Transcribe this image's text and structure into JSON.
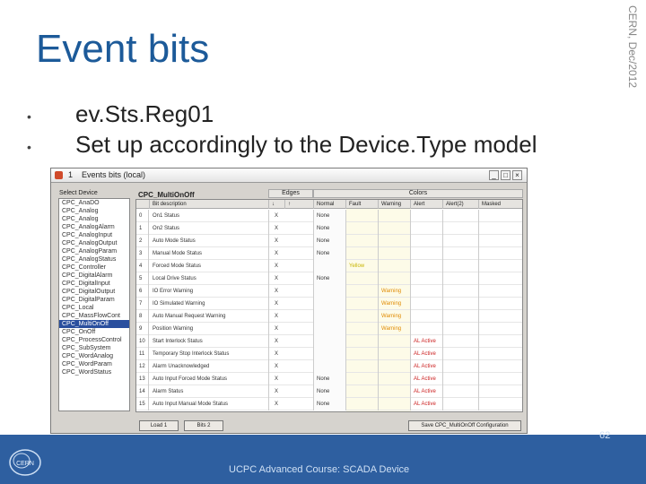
{
  "slide": {
    "title": "Event bits",
    "side_label": "CERN, Dec/2012",
    "bullets": [
      "ev.Sts.Reg01",
      "Set up accordingly to the Device.Type model"
    ],
    "footer_text": "UCPC Advanced Course: SCADA Device",
    "page_number": "62",
    "logo_text": "CERN",
    "footer_color": "#2e5fa0",
    "title_color": "#1c5a99"
  },
  "window": {
    "number": "1",
    "title": "Events bits (local)",
    "controls": [
      "_",
      "□",
      "×"
    ],
    "select_label": "Select Device",
    "model_name": "CPC_MultiOnOff",
    "group_edges": "Edges",
    "group_colors": "Colors",
    "headers": [
      "",
      "Bit description",
      "↓",
      "↑",
      "Normal",
      "Fault",
      "Warning",
      "Alert",
      "Alert(2)",
      "Masked"
    ],
    "devices": [
      "CPC_AnaDO",
      "CPC_Analog",
      "CPC_Analog",
      "CPC_AnalogAlarm",
      "CPC_AnalogInput",
      "CPC_AnalogOutput",
      "CPC_AnalogParam",
      "CPC_AnalogStatus",
      "CPC_Controller",
      "CPC_DigitalAlarm",
      "CPC_DigitalInput",
      "CPC_DigitalOutput",
      "CPC_DigitalParam",
      "CPC_Local",
      "CPC_MassFlowCont",
      "CPC_MultiOnOff",
      "CPC_OnOff",
      "CPC_ProcessControl",
      "CPC_SubSystem",
      "CPC_WordAnalog",
      "CPC_WordParam",
      "CPC_WordStatus"
    ],
    "selected_device": "CPC_MultiOnOff",
    "rows": [
      {
        "n": "0",
        "name": "On1 Status",
        "edge": "X",
        "normal": "None",
        "fault": "",
        "warn": "",
        "alert": ""
      },
      {
        "n": "1",
        "name": "On2 Status",
        "edge": "X",
        "normal": "None",
        "fault": "",
        "warn": "",
        "alert": ""
      },
      {
        "n": "2",
        "name": "Auto Mode Status",
        "edge": "X",
        "normal": "None",
        "fault": "",
        "warn": "",
        "alert": ""
      },
      {
        "n": "3",
        "name": "Manual Mode Status",
        "edge": "X",
        "normal": "None",
        "fault": "",
        "warn": "",
        "alert": ""
      },
      {
        "n": "4",
        "name": "Forced Mode Status",
        "edge": "X",
        "normal": "",
        "fault": "Yellow",
        "warn": "",
        "alert": ""
      },
      {
        "n": "5",
        "name": "Local Drive Status",
        "edge": "X",
        "normal": "None",
        "fault": "",
        "warn": "",
        "alert": ""
      },
      {
        "n": "6",
        "name": "IO Error Warning",
        "edge": "X",
        "normal": "",
        "fault": "",
        "warn": "Warning",
        "alert": ""
      },
      {
        "n": "7",
        "name": "IO Simulated Warning",
        "edge": "X",
        "normal": "",
        "fault": "",
        "warn": "Warning",
        "alert": ""
      },
      {
        "n": "8",
        "name": "Auto Manual Request Warning",
        "edge": "X",
        "normal": "",
        "fault": "",
        "warn": "Warning",
        "alert": ""
      },
      {
        "n": "9",
        "name": "Position Warning",
        "edge": "X",
        "normal": "",
        "fault": "",
        "warn": "Warning",
        "alert": ""
      },
      {
        "n": "10",
        "name": "Start Interlock Status",
        "edge": "X",
        "normal": "",
        "fault": "",
        "warn": "",
        "alert": "AL Active"
      },
      {
        "n": "11",
        "name": "Temporary Stop Interlock Status",
        "edge": "X",
        "normal": "",
        "fault": "",
        "warn": "",
        "alert": "AL Active"
      },
      {
        "n": "12",
        "name": "Alarm Unacknowledged",
        "edge": "X",
        "normal": "",
        "fault": "",
        "warn": "",
        "alert": "AL Active"
      },
      {
        "n": "13",
        "name": "Auto Input Forced Mode Status",
        "edge": "X",
        "normal": "None",
        "fault": "",
        "warn": "",
        "alert": "AL Active"
      },
      {
        "n": "14",
        "name": "Alarm Status",
        "edge": "X",
        "normal": "None",
        "fault": "",
        "warn": "",
        "alert": "AL Active"
      },
      {
        "n": "15",
        "name": "Auto Input Manual Mode Status",
        "edge": "X",
        "normal": "None",
        "fault": "",
        "warn": "",
        "alert": "AL Active"
      }
    ],
    "buttons": {
      "b1": "Load 1",
      "b2": "Bits 2",
      "save": "Save CPC_MultiOnOff Configuration"
    },
    "colors": {
      "warning": "#e08a00",
      "alert": "#cc2222",
      "yellow": "#c8b400",
      "selected": "#2a4f9e"
    }
  }
}
